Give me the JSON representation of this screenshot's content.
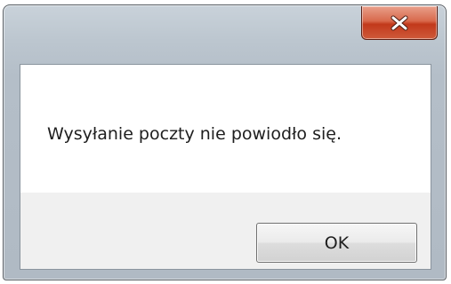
{
  "dialog": {
    "message": "Wysyłanie poczty nie powiodło się.",
    "ok_label": "OK",
    "close_icon": "close-icon"
  },
  "colors": {
    "close_button": "#c2391b",
    "window_frame": "#b4bec8",
    "button_area": "#f0f0f0"
  }
}
